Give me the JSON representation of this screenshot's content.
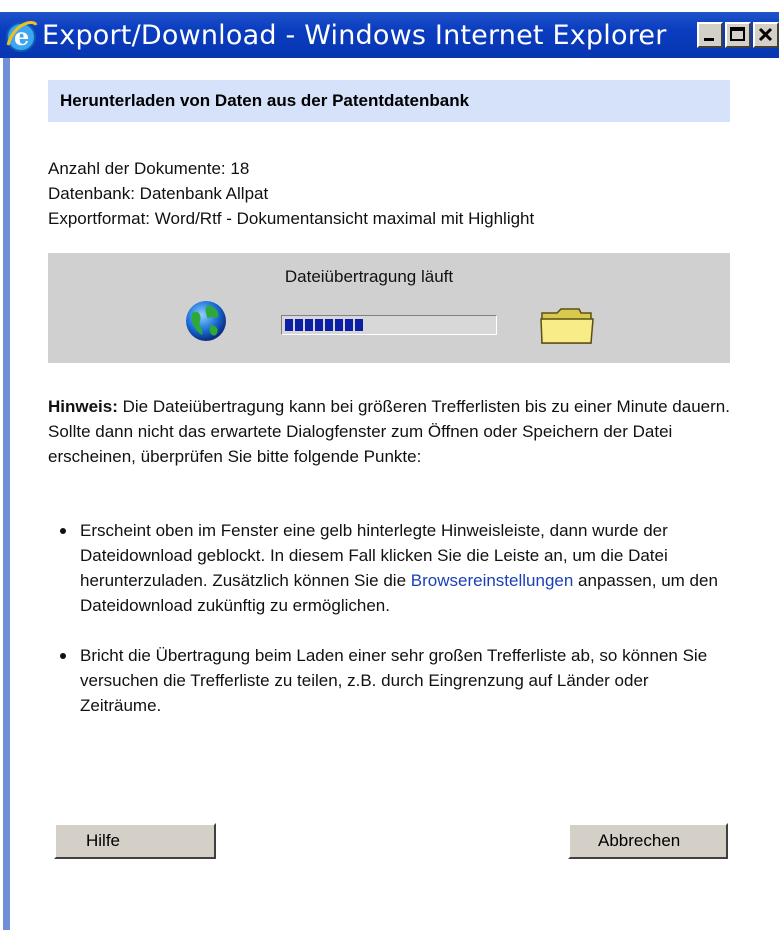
{
  "window": {
    "title": "Export/Download - Windows Internet Explorer",
    "icon": "internet-explorer-icon",
    "controls": [
      "minimize-icon",
      "maximize-icon",
      "close-icon"
    ]
  },
  "header": {
    "title": "Herunterladen von Daten aus der Patentdatenbank"
  },
  "info": {
    "count_line": "Anzahl der Dokumente: 18",
    "database_line": "Datenbank: Datenbank Allpat",
    "format_line": "Exportformat: Word/Rtf - Dokumentansicht maximal mit Highlight"
  },
  "progress": {
    "label": "Dateiübertragung läuft",
    "source_icon": "globe-icon",
    "target_icon": "folder-icon",
    "filled_segments": 8,
    "fraction": 0.42,
    "bar_color": "#0a1ea8"
  },
  "hint": {
    "label": "Hinweis:",
    "text": " Die Dateiübertragung kann bei größeren Trefferlisten bis zu einer Minute dauern. Sollte dann nicht das erwartete Dialogfenster zum Öffnen oder Speichern der Datei erscheinen, überprüfen Sie bitte folgende Punkte:"
  },
  "bullets": {
    "item1_before": "Erscheint oben im Fenster eine gelb hinterlegte Hinweisleiste, dann wurde der Dateidownload geblockt. In diesem Fall klicken Sie die Leiste an, um die Datei herunterzuladen. Zusätzlich können Sie die ",
    "item1_link": "Browsereinstellungen",
    "item1_after": " anpassen, um den Dateidownload zukünftig zu ermöglichen.",
    "item2": "Bricht die Übertragung beim Laden einer sehr großen Trefferliste ab, so können Sie versuchen die Trefferliste zu teilen, z.B. durch Eingrenzung auf Länder oder Zeiträume."
  },
  "buttons": {
    "help_label": "Hilfe",
    "cancel_label": "Abbrechen"
  },
  "colors": {
    "titlebar": "#0a3cc0",
    "header_bg": "#d6e2f9",
    "panel_bg": "#d0d0d0",
    "link": "#1a3fb8"
  }
}
